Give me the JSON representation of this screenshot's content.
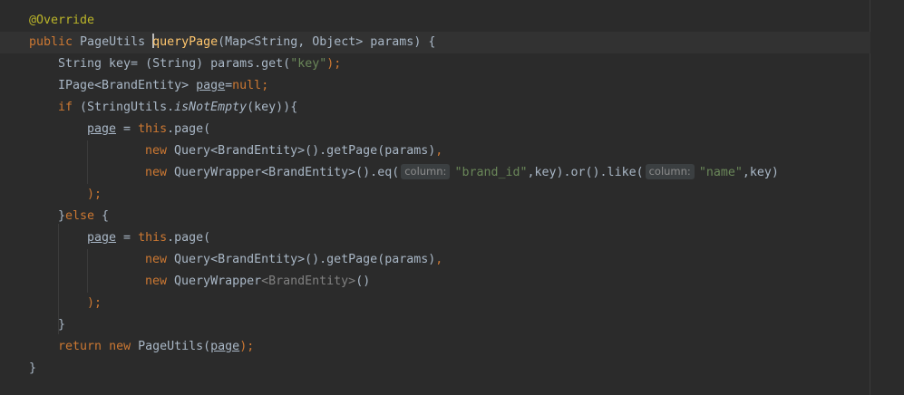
{
  "editor": {
    "language": "java",
    "colors": {
      "background": "#2b2b2b",
      "text": "#a9b7c6",
      "keyword": "#cc7832",
      "annotation": "#bbb529",
      "string": "#6a8759",
      "method_declaration": "#ffc66d",
      "parameter_hint_bg": "#3b3f41"
    },
    "lines": [
      {
        "annotation": "@Override"
      },
      {
        "kw_public": "public",
        "return_type": " PageUtils ",
        "method_name": "queryPage",
        "signature": "(Map<String, Object> params) {"
      },
      {
        "text_a": "String key= (String) params.get(",
        "str_key": "\"key\"",
        "text_b": ");"
      },
      {
        "text_a": "IPage<BrandEntity> ",
        "var_page": "page",
        "text_b": "=",
        "kw_null": "null",
        "text_c": ";"
      },
      {
        "kw_if": "if",
        "text_a": " (StringUtils.",
        "method_italic": "isNotEmpty",
        "text_b": "(key)){"
      },
      {
        "var_page": "page",
        "text_a": " = ",
        "kw_this": "this",
        "text_b": ".page("
      },
      {
        "kw_new": "new",
        "text_a": " Query<BrandEntity>().getPage(params)",
        "comma": ","
      },
      {
        "kw_new": "new",
        "text_a": " QueryWrapper<BrandEntity>().eq(",
        "hint_1": "column:",
        "str_1": "\"brand_id\"",
        "text_b": ",key).or().like(",
        "hint_2": "column:",
        "str_2": "\"name\"",
        "text_c": ",key)"
      },
      {
        "text": ");"
      },
      {
        "text_a": "}",
        "kw_else": "else",
        "text_b": " {"
      },
      {
        "var_page": "page",
        "text_a": " = ",
        "kw_this": "this",
        "text_b": ".page("
      },
      {
        "kw_new": "new",
        "text_a": " Query<BrandEntity>().getPage(params)",
        "comma": ","
      },
      {
        "kw_new": "new",
        "text_a": " QueryWrapper",
        "text_dim": "<BrandEntity>",
        "text_b": "()"
      },
      {
        "text": ");"
      },
      {
        "text": "}"
      },
      {
        "kw_return": "return",
        "text_a": " ",
        "kw_new": "new",
        "text_b": " PageUtils(",
        "var_page": "page",
        "text_c": ");"
      },
      {
        "text": "}"
      }
    ]
  }
}
